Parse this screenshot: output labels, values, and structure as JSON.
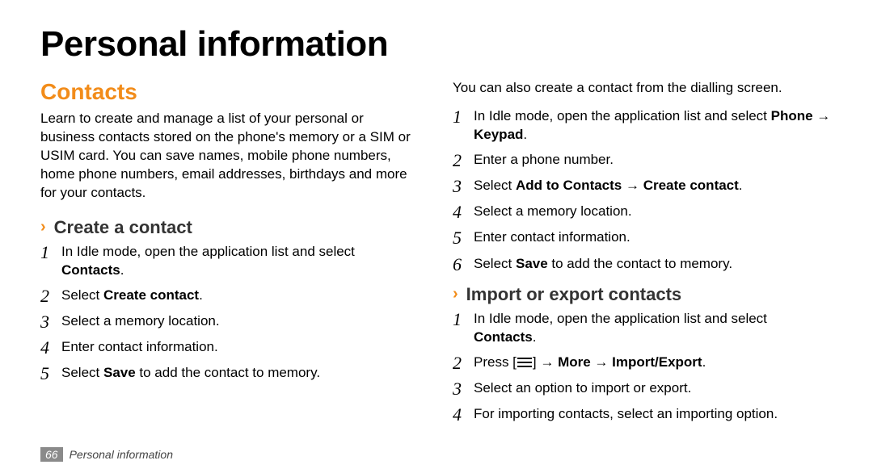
{
  "title": "Personal information",
  "section": "Contacts",
  "intro": "Learn to create and manage a list of your personal or business contacts stored on the phone's memory or a SIM or USIM card. You can save names, mobile phone numbers, home phone numbers, email addresses, birthdays and more for your contacts.",
  "create": {
    "heading": "Create a contact",
    "steps": {
      "s1a": "In Idle mode, open the application list and select ",
      "s1b": "Contacts",
      "s1c": ".",
      "s2a": "Select ",
      "s2b": "Create contact",
      "s2c": ".",
      "s3": "Select a memory location.",
      "s4": "Enter contact information.",
      "s5a": "Select ",
      "s5b": "Save",
      "s5c": " to add the contact to memory."
    }
  },
  "dialling": {
    "lead": "You can also create a contact from the dialling screen.",
    "steps": {
      "s1a": "In Idle mode, open the application list and select ",
      "s1b": "Phone → Keypad",
      "s1c": ".",
      "s2": "Enter a phone number.",
      "s3a": "Select ",
      "s3b": "Add to Contacts → Create contact",
      "s3c": ".",
      "s4": "Select a memory location.",
      "s5": "Enter contact information.",
      "s6a": "Select ",
      "s6b": "Save",
      "s6c": " to add the contact to memory."
    }
  },
  "importexport": {
    "heading": "Import or export contacts",
    "steps": {
      "s1a": "In Idle mode, open the application list and select ",
      "s1b": "Contacts",
      "s1c": ".",
      "s2a": "Press [",
      "s2b": "] → ",
      "s2c": "More → Import/Export",
      "s2d": ".",
      "s3": "Select an option to import or export.",
      "s4": "For importing contacts, select an importing option."
    }
  },
  "footer": {
    "page": "66",
    "label": "Personal information"
  },
  "nums": {
    "n1": "1",
    "n2": "2",
    "n3": "3",
    "n4": "4",
    "n5": "5",
    "n6": "6"
  },
  "chev": "›"
}
